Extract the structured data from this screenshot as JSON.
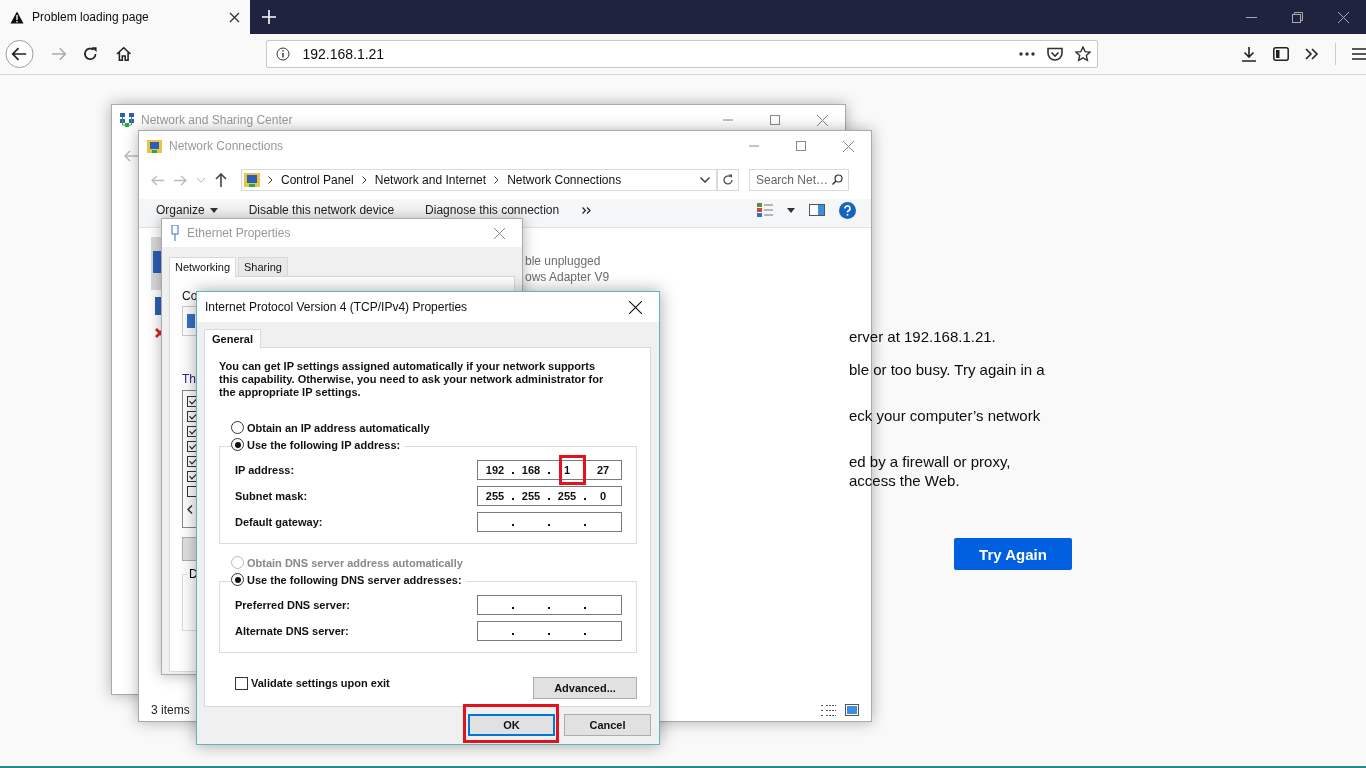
{
  "browser": {
    "tab": {
      "title": "Problem loading page",
      "selected": true
    },
    "url": "192.168.1.21"
  },
  "error_page": {
    "lines": [
      "erver at 192.168.1.21.",
      "ble or too busy. Try again in a",
      "eck your computer’s network",
      "ed by a firewall or proxy,",
      "access the Web."
    ],
    "button": "Try Again"
  },
  "sharing_center": {
    "title": "Network and Sharing Center"
  },
  "network_connections": {
    "title": "Network Connections",
    "breadcrumb": [
      "Control Panel",
      "Network and Internet",
      "Network Connections"
    ],
    "search_placeholder": "Search Net…",
    "toolbar": [
      "Organize",
      "Disable this network device",
      "Diagnose this connection"
    ],
    "adapter_lines": [
      "ble unplugged",
      "ows Adapter V9"
    ],
    "status": "3 items"
  },
  "ethernet_properties": {
    "title": "Ethernet Properties",
    "tabs": [
      {
        "label": "Networking",
        "selected": true
      },
      {
        "label": "Sharing",
        "selected": false
      }
    ],
    "connect_label": "Co",
    "items_label": "Th",
    "description_label": "D",
    "components": [
      {
        "checked": true
      },
      {
        "checked": true
      },
      {
        "checked": true
      },
      {
        "checked": true
      },
      {
        "checked": true
      },
      {
        "checked": true
      },
      {
        "checked": false
      }
    ]
  },
  "ipv4": {
    "title": "Internet Protocol Version 4 (TCP/IPv4) Properties",
    "tabs": [
      {
        "label": "General",
        "selected": true
      }
    ],
    "intro": "You can get IP settings assigned automatically if your network supports this capability. Otherwise, you need to ask your network administrator for the appropriate IP settings.",
    "ip_options": [
      {
        "label": "Obtain an IP address automatically",
        "selected": false,
        "disabled": false
      },
      {
        "label": "Use the following IP address:",
        "selected": true,
        "disabled": false
      }
    ],
    "ip_fields": [
      {
        "label": "IP address:",
        "octets": [
          {
            "value": "192",
            "highlighted": false
          },
          {
            "value": "168",
            "highlighted": false
          },
          {
            "value": "1",
            "highlighted": true
          },
          {
            "value": "27",
            "highlighted": false
          }
        ]
      },
      {
        "label": "Subnet mask:",
        "octets": [
          {
            "value": "255",
            "highlighted": false
          },
          {
            "value": "255",
            "highlighted": false
          },
          {
            "value": "255",
            "highlighted": false
          },
          {
            "value": "0",
            "highlighted": false
          }
        ]
      },
      {
        "label": "Default gateway:"
      }
    ],
    "dns_options": [
      {
        "label": "Obtain DNS server address automatically",
        "selected": false,
        "disabled": true
      },
      {
        "label": "Use the following DNS server addresses:",
        "selected": true,
        "disabled": false
      }
    ],
    "dns_fields": [
      {
        "label": "Preferred DNS server:"
      },
      {
        "label": "Alternate DNS server:"
      }
    ],
    "validate": {
      "label": "Validate settings upon exit",
      "checked": false
    },
    "advanced": "Advanced...",
    "buttons": [
      {
        "label": "OK",
        "default": true,
        "highlighted": true
      },
      {
        "label": "Cancel",
        "default": false,
        "highlighted": false
      }
    ]
  }
}
